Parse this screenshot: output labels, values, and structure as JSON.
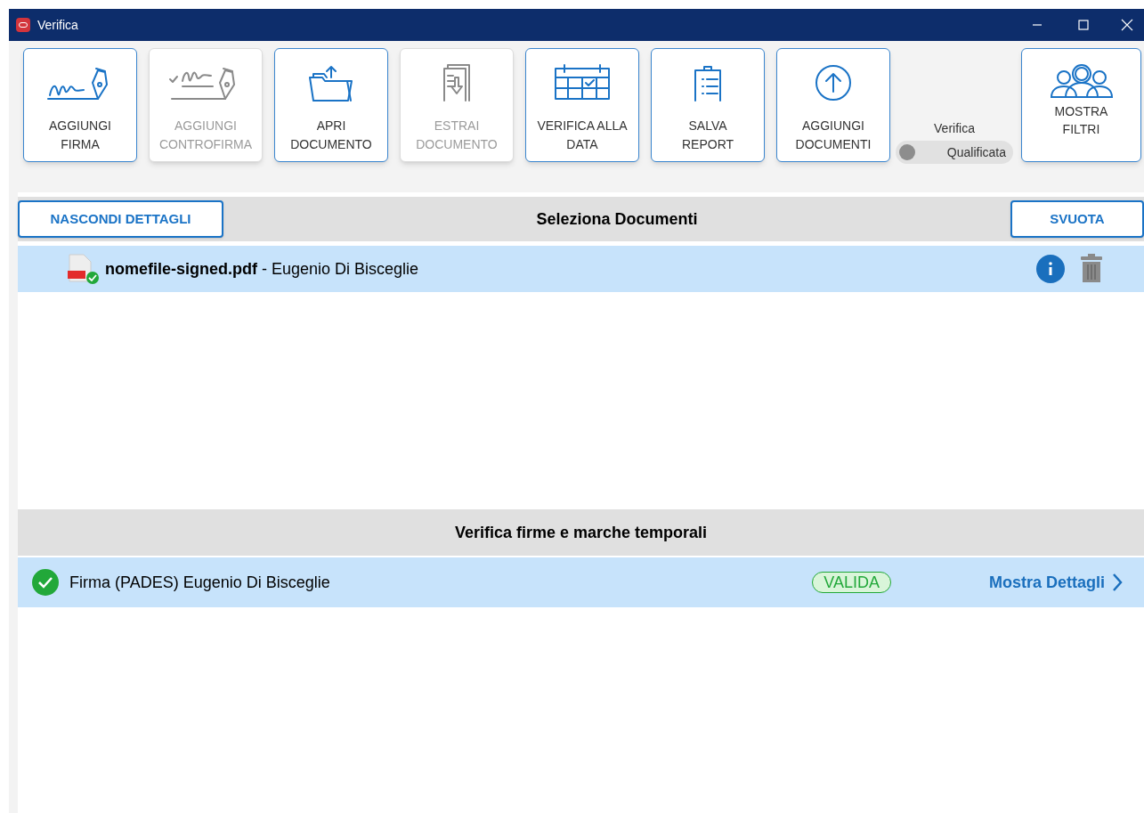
{
  "window": {
    "title": "Verifica"
  },
  "toolbar": {
    "buttons": [
      {
        "kind": "signature",
        "label": "AGGIUNGI\nFIRMA",
        "disabled": false
      },
      {
        "kind": "countersign",
        "label": "AGGIUNGI\nCONTROFIRMA",
        "disabled": true
      },
      {
        "kind": "folder",
        "label": "APRI\nDOCUMENTO",
        "disabled": false
      },
      {
        "kind": "extract",
        "label": "ESTRAI\nDOCUMENTO",
        "disabled": true
      },
      {
        "kind": "calendar",
        "label": "VERIFICA ALLA\nDATA",
        "disabled": false
      },
      {
        "kind": "report",
        "label": "SALVA\nREPORT",
        "disabled": false
      },
      {
        "kind": "upload",
        "label": "AGGIUNGI\nDOCUMENTI",
        "disabled": false
      }
    ],
    "toggle": {
      "label": "Verifica",
      "value": "Qualificata",
      "on": false
    },
    "filters_button": {
      "label": "MOSTRA\nFILTRI"
    }
  },
  "documents": {
    "title": "Seleziona Documenti",
    "left_button": "NASCONDI DETTAGLI",
    "right_button": "SVUOTA",
    "rows": [
      {
        "file": "nomefile-signed.pdf",
        "signer": " - Eugenio Di Bisceglie",
        "selected": true
      }
    ]
  },
  "signatures": {
    "title": "Verifica firme e marche temporali",
    "rows": [
      {
        "name": "Firma (PADES) Eugenio Di Bisceglie",
        "status": "VALIDA",
        "valid": true,
        "link": "Mostra Dettagli",
        "selected": true
      }
    ]
  }
}
